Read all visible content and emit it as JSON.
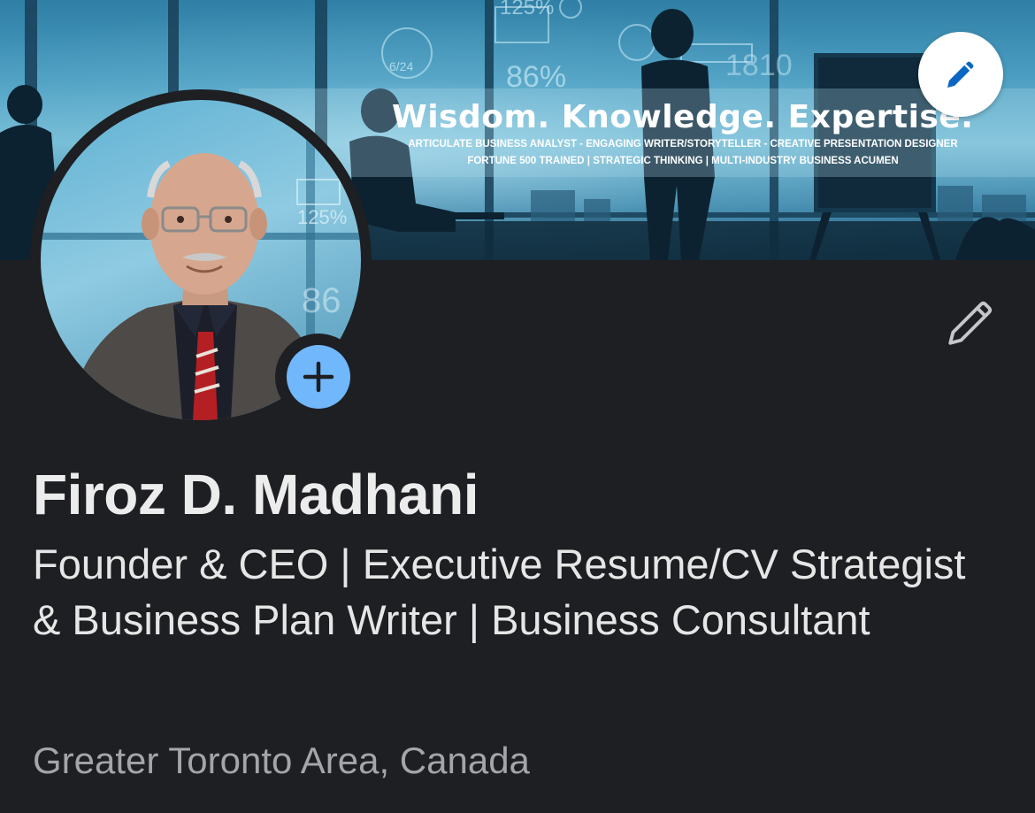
{
  "banner": {
    "title": "Wisdom. Knowledge. Expertise.",
    "line1": "ARTICULATE BUSINESS ANALYST - ENGAGING WRITER/STORYTELLER - CREATIVE PRESENTATION DESIGNER",
    "line2": "FORTUNE 500 TRAINED | STRATEGIC THINKING | MULTI-INDUSTRY BUSINESS ACUMEN",
    "edit_icon": "pencil-icon"
  },
  "profile": {
    "name": "Firoz D. Madhani",
    "headline": "Founder & CEO | Executive Resume/CV Strategist & Business Plan Writer | Business Consultant",
    "location": "Greater Toronto Area, Canada",
    "add_photo_icon": "plus-icon",
    "edit_intro_icon": "pencil-icon"
  },
  "colors": {
    "background": "#1d1f22",
    "accent": "#71b7fb",
    "edit_icon_blue": "#0a66c2",
    "text_primary": "#ececec",
    "text_secondary": "#a3a5a8"
  }
}
